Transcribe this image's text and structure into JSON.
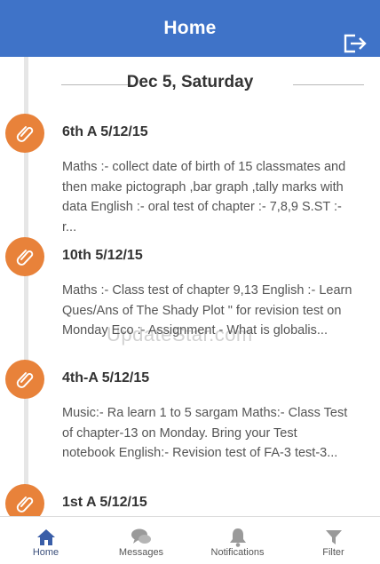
{
  "header": {
    "title": "Home",
    "logout_icon": "logout-icon"
  },
  "date_heading": "Dec 5, Saturday",
  "feed": [
    {
      "title": "6th A 5/12/15",
      "text": "Maths :- collect date of birth of 15 classmates and then make pictograph ,bar graph ,tally marks with data English :- oral test of chapter :- 7,8,9 S.ST :- r..."
    },
    {
      "title": "10th 5/12/15",
      "text": "Maths :- Class test of chapter 9,13 English :- Learn Ques/Ans of  The Shady Plot \" for  revision test on Monday Eco :- Assignment - What is globalis..."
    },
    {
      "title": "4th-A 5/12/15",
      "text": "Music:- Ra learn 1 to 5 sargam Maths:- Class Test of chapter-13 on Monday. Bring your Test notebook English:- Revision test of FA-3 test-3..."
    },
    {
      "title": "1st A 5/12/15",
      "text": ""
    }
  ],
  "watermark": "UpdateStar.com",
  "tabs": [
    {
      "label": "Home",
      "icon": "home-icon",
      "active": true
    },
    {
      "label": "Messages",
      "icon": "chat-icon",
      "active": false
    },
    {
      "label": "Notifications",
      "icon": "bell-icon",
      "active": false
    },
    {
      "label": "Filter",
      "icon": "filter-icon",
      "active": false
    }
  ],
  "colors": {
    "header": "#3f73c8",
    "badge": "#e8823a",
    "active_tab": "#3a5ea8",
    "inactive_tab": "#9a9a9a"
  }
}
